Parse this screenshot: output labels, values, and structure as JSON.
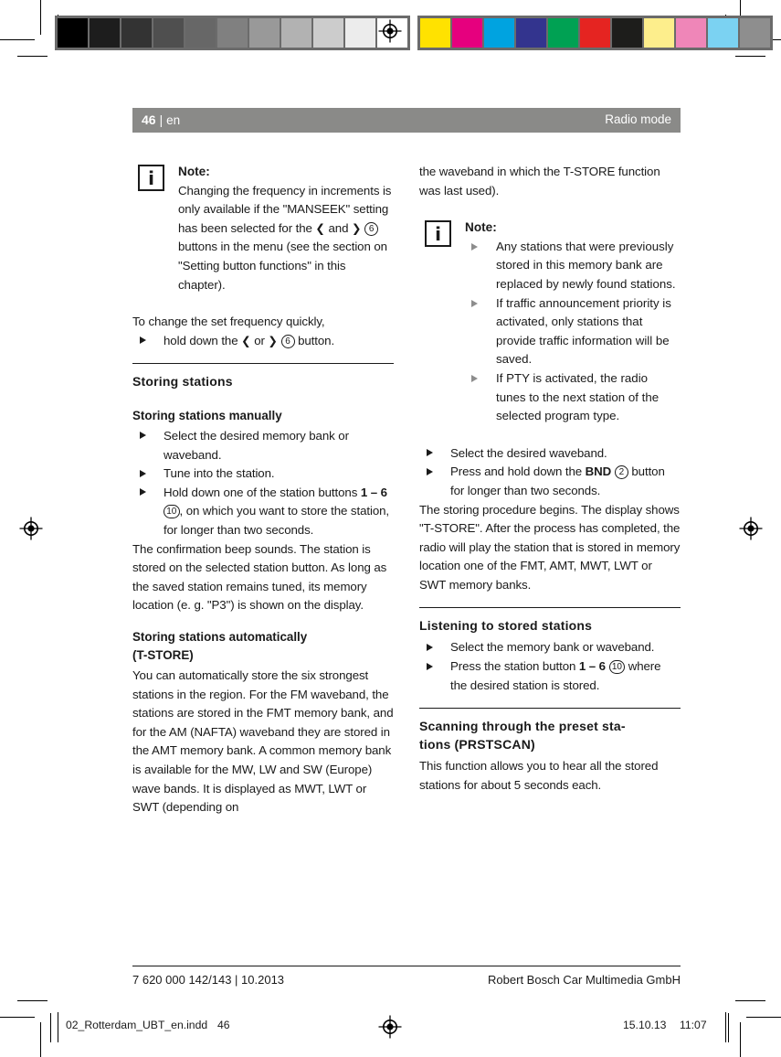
{
  "marks": {
    "registration_icon": "registration-target-icon",
    "gray_patches": [
      "#000000",
      "#1d1d1d",
      "#333333",
      "#4f4f4f",
      "#676767",
      "#808080",
      "#999999",
      "#b2b2b2",
      "#cccccc",
      "#ececec",
      "#ffffff"
    ],
    "color_patches": [
      "#ffe200",
      "#e6007e",
      "#00a3e0",
      "#33348e",
      "#00a153",
      "#e52421",
      "#1d1d1b",
      "#fdee8c",
      "#ef86b8",
      "#7bd2f2",
      "#8e8e8e"
    ]
  },
  "header": {
    "page_number": "46",
    "separator": "|",
    "language": "en",
    "section_title": "Radio mode"
  },
  "left_column": {
    "note": {
      "icon": "info-icon",
      "icon_glyph": "i",
      "title": "Note:",
      "body": "Changing the frequency in increments is only available if the \"MANSEEK\" setting has been selected for the ",
      "body_mid": " and ",
      "body_after_circle": " buttons in the menu (see the section on \"Setting button functions\" in this chapter).",
      "arrow_left": "❮",
      "arrow_right": "❯",
      "circle_num": "6"
    },
    "quick_change_intro": "To change the set frequency quickly,",
    "quick_change_step": {
      "prefix": "hold down the ",
      "arrow_left": "❮",
      "middle": " or ",
      "arrow_right": "❯",
      "circle_num": "6",
      "suffix": " button."
    },
    "section_storing": "Storing stations",
    "sub_manual": "Storing stations manually",
    "manual_steps": [
      "Select the desired memory bank or waveband.",
      "Tune into the station."
    ],
    "manual_step3": {
      "prefix": "Hold down one of the station buttons ",
      "bold1": "1 – 6",
      "circle_num": "10",
      "suffix": ", on which you want to store the station, for longer than two seconds."
    },
    "manual_para": "The confirmation beep sounds. The station is stored on the selected station button. As long as the saved station remains tuned, its memory location (e. g. \"P3\") is shown on the display.",
    "sub_auto_line1": "Storing stations automatically",
    "sub_auto_line2": "(T-STORE)",
    "auto_para": "You can automatically store the six strongest stations in the region. For the FM waveband, the stations are stored in the FMT memory bank, and for the AM (NAFTA) waveband they are stored in the AMT memory bank. A common memory bank is available for the MW, LW and SW (Europe) wave bands. It is displayed as MWT, LWT or SWT (depending on"
  },
  "right_column": {
    "continuation_para": "the waveband in which the T-STORE function was last used).",
    "note": {
      "icon": "info-icon",
      "icon_glyph": "i",
      "title": "Note:",
      "bullets": [
        "Any stations that were previously stored in this memory bank are replaced by newly found stations.",
        "If traffic announcement priority is activated, only stations that provide traffic information will be saved.",
        "If PTY is activated, the radio tunes to the next station of the selected program type."
      ]
    },
    "tstore_step1": "Select the desired waveband.",
    "tstore_step2": {
      "prefix": "Press and hold down the ",
      "bold1": "BND",
      "circle_num": "2",
      "suffix": " button for longer than two seconds."
    },
    "tstore_para": "The storing procedure begins. The display shows \"T-STORE\". After the process has completed, the radio will play the station that is stored in memory location one of the FMT, AMT, MWT, LWT or SWT memory banks.",
    "section_listening": "Listening to stored stations",
    "listening_step1": "Select the memory bank or waveband.",
    "listening_step2": {
      "prefix": "Press the station button ",
      "bold1": "1 – 6",
      "circle_num": "10",
      "suffix": " where the desired station is stored."
    },
    "section_scanning_line1": "Scanning through the preset sta-",
    "section_scanning_line2": "tions (PRSTSCAN)",
    "scanning_para": "This function allows you to hear all the stored stations for about 5 seconds each."
  },
  "footer": {
    "left": "7 620 000 142/143 | 10.2013",
    "right": "Robert Bosch Car Multimedia GmbH"
  },
  "production_bar": {
    "filename": "02_Rotterdam_UBT_en.indd",
    "page": "46",
    "date": "15.10.13",
    "time": "11:07",
    "registration_icon": "registration-target-icon"
  }
}
